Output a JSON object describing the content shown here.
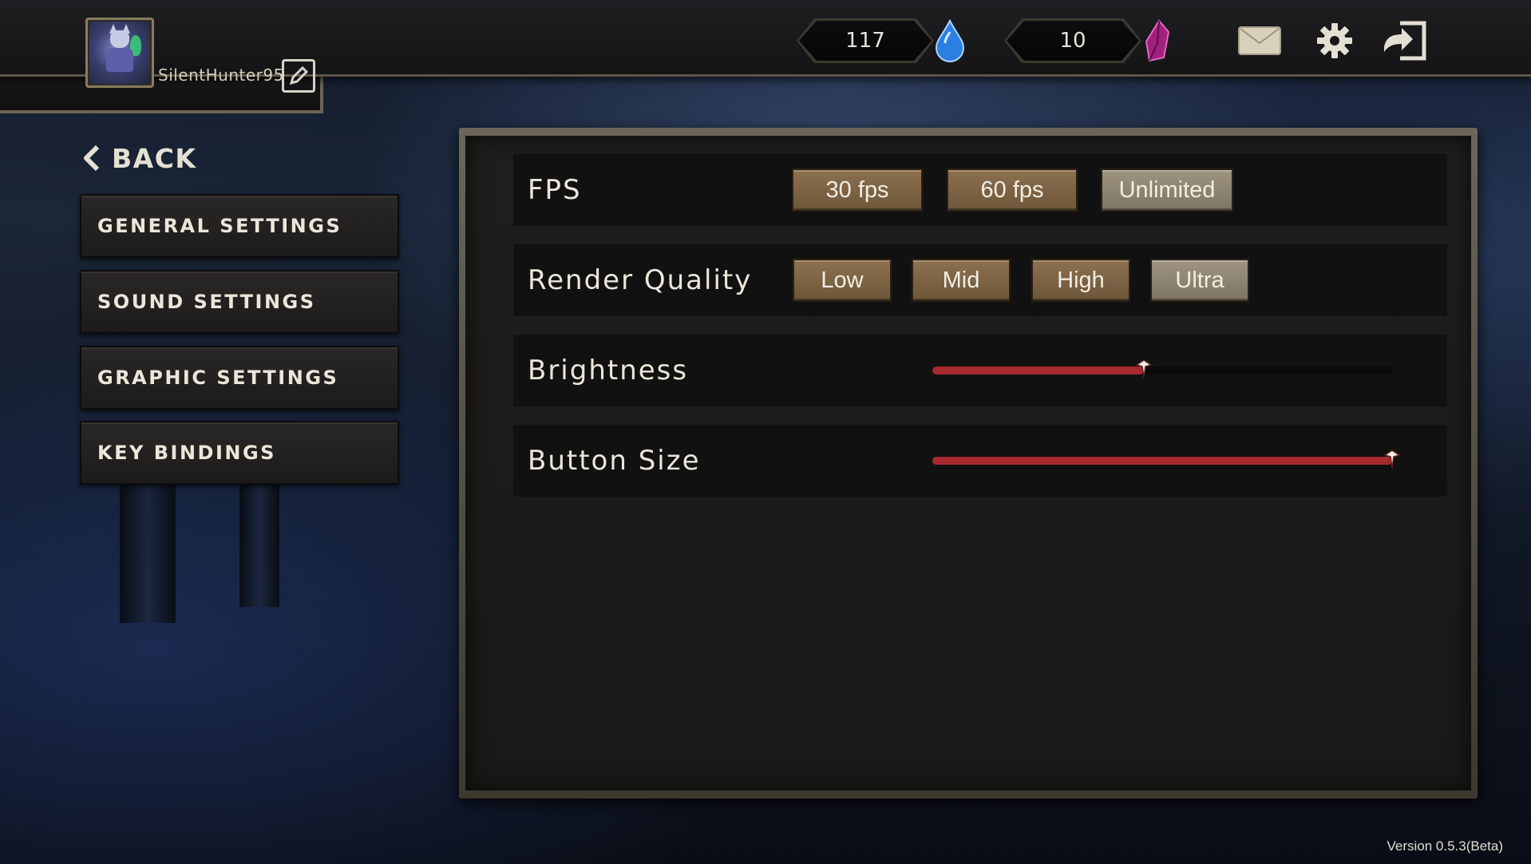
{
  "header": {
    "username": "SilentHunter95",
    "currencies": [
      {
        "icon": "blue-drop-gem-icon",
        "value": "117"
      },
      {
        "icon": "purple-crystal-gem-icon",
        "value": "10"
      }
    ],
    "icons": [
      "mail-icon",
      "gear-icon",
      "logout-icon"
    ]
  },
  "sidebar": {
    "back_label": "BACK",
    "items": [
      {
        "label": "GENERAL SETTINGS"
      },
      {
        "label": "SOUND SETTINGS"
      },
      {
        "label": "GRAPHIC SETTINGS"
      },
      {
        "label": "KEY BINDINGS"
      }
    ]
  },
  "settings": {
    "fps": {
      "label": "FPS",
      "options": [
        "30 fps",
        "60 fps",
        "Unlimited"
      ],
      "selected": "Unlimited"
    },
    "render_quality": {
      "label": "Render Quality",
      "options": [
        "Low",
        "Mid",
        "High",
        "Ultra"
      ],
      "selected": "Ultra"
    },
    "brightness": {
      "label": "Brightness",
      "value": 0.46
    },
    "button_size": {
      "label": "Button Size",
      "value": 1.0
    }
  },
  "footer": {
    "version": "Version 0.5.3(Beta)"
  },
  "colors": {
    "accent_red": "#a8292f",
    "button_brown": "#7d6244",
    "selected_button": "#8d8471"
  }
}
